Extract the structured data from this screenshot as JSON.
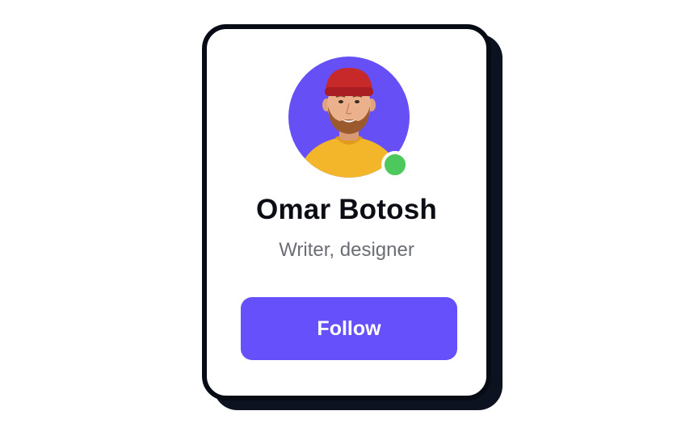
{
  "profile": {
    "name": "Omar Botosh",
    "role": "Writer, designer",
    "status": "online",
    "avatar_icon": "user-avatar"
  },
  "actions": {
    "follow_label": "Follow"
  },
  "colors": {
    "accent": "#6650fb",
    "online": "#4cc85c",
    "avatar_bg": "#6650f5",
    "card_border": "#070b14"
  }
}
